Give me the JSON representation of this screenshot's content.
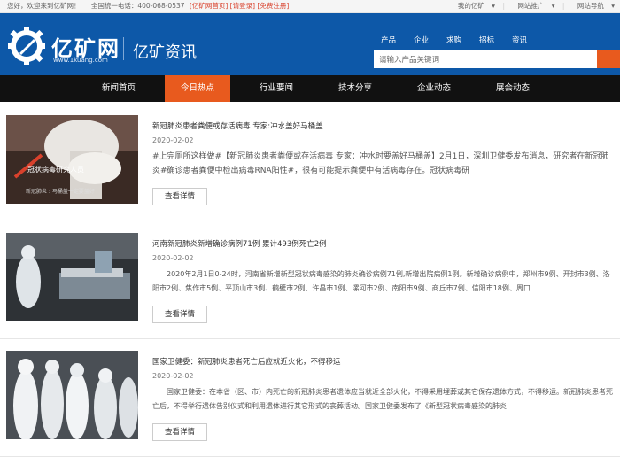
{
  "topbar": {
    "welcome": "您好，欢迎来到亿矿网！",
    "hotline": "全国统一电话：400-068-0537",
    "home_link": "[亿矿网首页]",
    "login_link": "[请登录]",
    "register_link": "[免费注册]",
    "my_account": "我的亿矿",
    "site_promo": "网站推广",
    "nav_more": "网站导航"
  },
  "header": {
    "brand": "亿矿网",
    "brand_url": "www.1kuang.com",
    "subtitle": "亿矿资讯",
    "search_tabs": [
      "产品",
      "企业",
      "求购",
      "招标",
      "资讯"
    ],
    "search_placeholder": "请输入产品关键词"
  },
  "nav": {
    "items": [
      "新闻首页",
      "今日热点",
      "行业要闻",
      "技术分享",
      "企业动态",
      "展会动态"
    ],
    "active": "今日热点"
  },
  "articles": [
    {
      "title": "新冠肺炎患者粪便或存活病毒 专家:冲水盖好马桶盖",
      "date": "2020-02-02",
      "summary": "#上完厕所这样做#【新冠肺炎患者粪便或存活病毒 专家：冲水时要盖好马桶盖】2月1日，深圳卫健委发布消息，研究者在新冠肺炎#确诊患者粪便中检出病毒RNA阳性#，很有可能提示粪便中有活病毒存在。冠状病毒研",
      "thumb_text": "冠状病毒研究人员",
      "thumb_text2": "新冠肺炎 : 马桶盖一定要盖好",
      "button": "查看详情"
    },
    {
      "title": "河南新冠肺炎新增确诊病例71例 累计493例死亡2例",
      "date": "2020-02-02",
      "summary": "2020年2月1日0-24时，河南省新增新型冠状病毒感染的肺炎确诊病例71例,新增出院病例1例。新增确诊病例中，郑州市9例、开封市3例、洛阳市2例、焦作市5例、平顶山市3例、鹤壁市2例、许昌市1例、漯河市2例、南阳市9例、商丘市7例、信阳市18例、周口",
      "button": "查看详情"
    },
    {
      "title": "国家卫健委：新冠肺炎患者死亡后应就近火化，不得移运",
      "date": "2020-02-02",
      "summary": "国家卫健委：在本省（区、市）内死亡的新冠肺炎患者遗体应当就近全部火化，不得采用埋葬或其它保存遗体方式，不得移运。新冠肺炎患者死亡后，不得举行遗体告别仪式和利用遗体进行其它形式的丧葬活动。国家卫健委发布了《新型冠状病毒感染的肺炎",
      "button": "查看详情"
    }
  ],
  "colors": {
    "header_blue": "#0d58a8",
    "accent_orange": "#e85a1e",
    "nav_black": "#111111"
  }
}
